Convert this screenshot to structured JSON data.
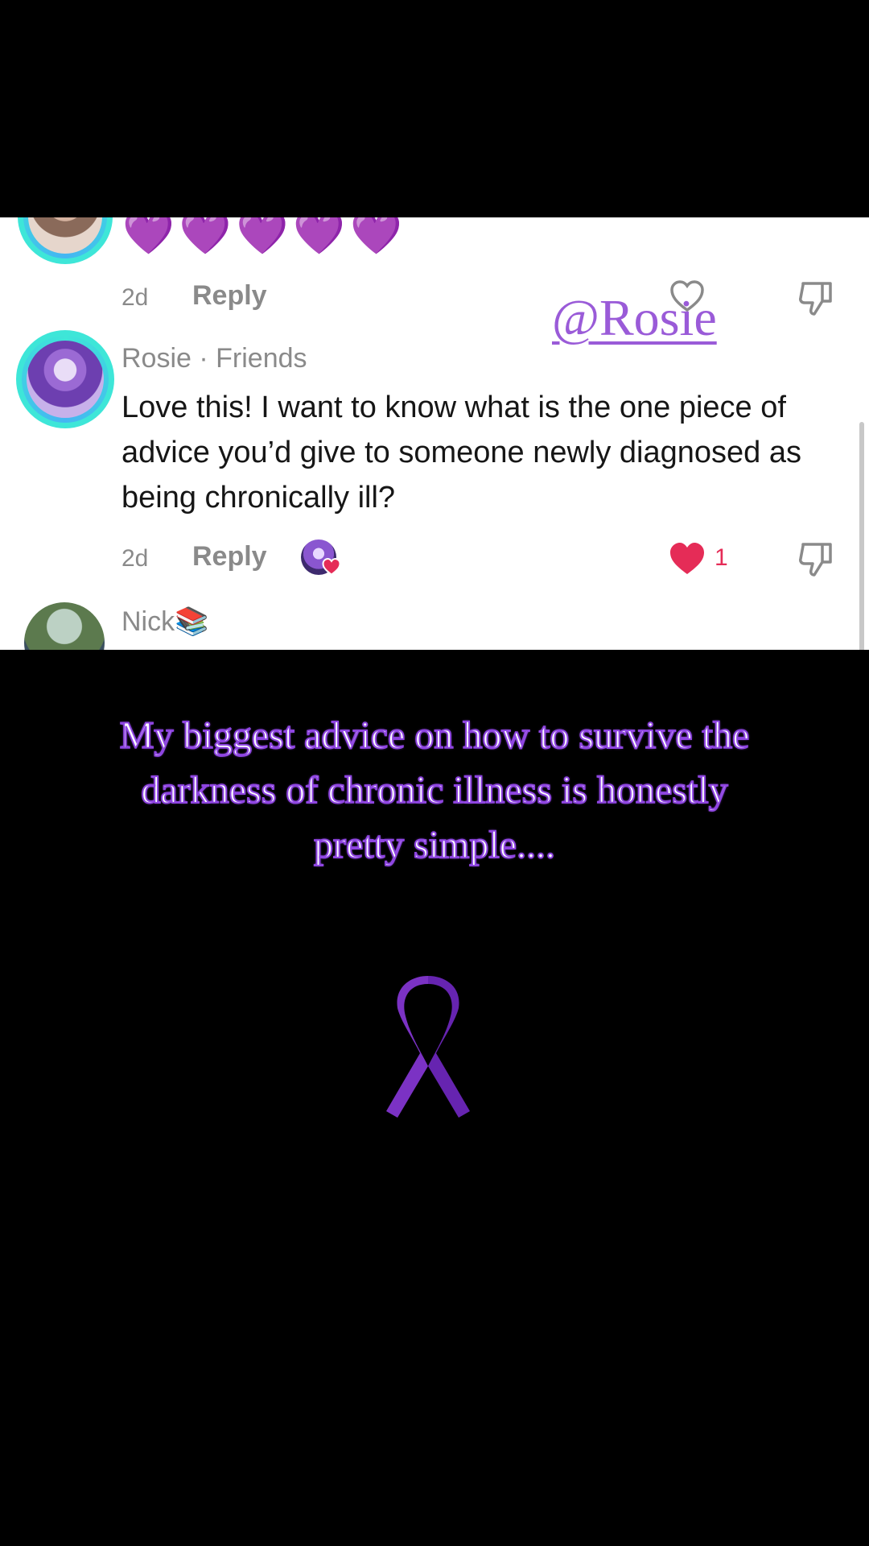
{
  "top_comment": {
    "emojis": [
      "💜",
      "💜",
      "💜",
      "💜",
      "💜"
    ],
    "time": "2d",
    "reply_label": "Reply"
  },
  "mention_overlay": "@Rosie",
  "rosie_comment": {
    "username": "Rosie · Friends",
    "text": "Love this! I want to know what is the one piece of advice you’d give to someone newly diagnosed as being chronically ill?",
    "time": "2d",
    "reply_label": "Reply",
    "like_count": "1"
  },
  "next_comment": {
    "username": "Nick📚"
  },
  "caption": "My biggest advice on how to survive the darkness of chronic illness is honestly pretty simple....",
  "colors": {
    "accent_purple": "#9a5bd8",
    "like_red": "#e52c57",
    "ring_teal": "#3ee6d8"
  },
  "icons": [
    "heart-outline-icon",
    "thumbs-down-icon",
    "heart-filled-icon",
    "awareness-ribbon-icon"
  ]
}
